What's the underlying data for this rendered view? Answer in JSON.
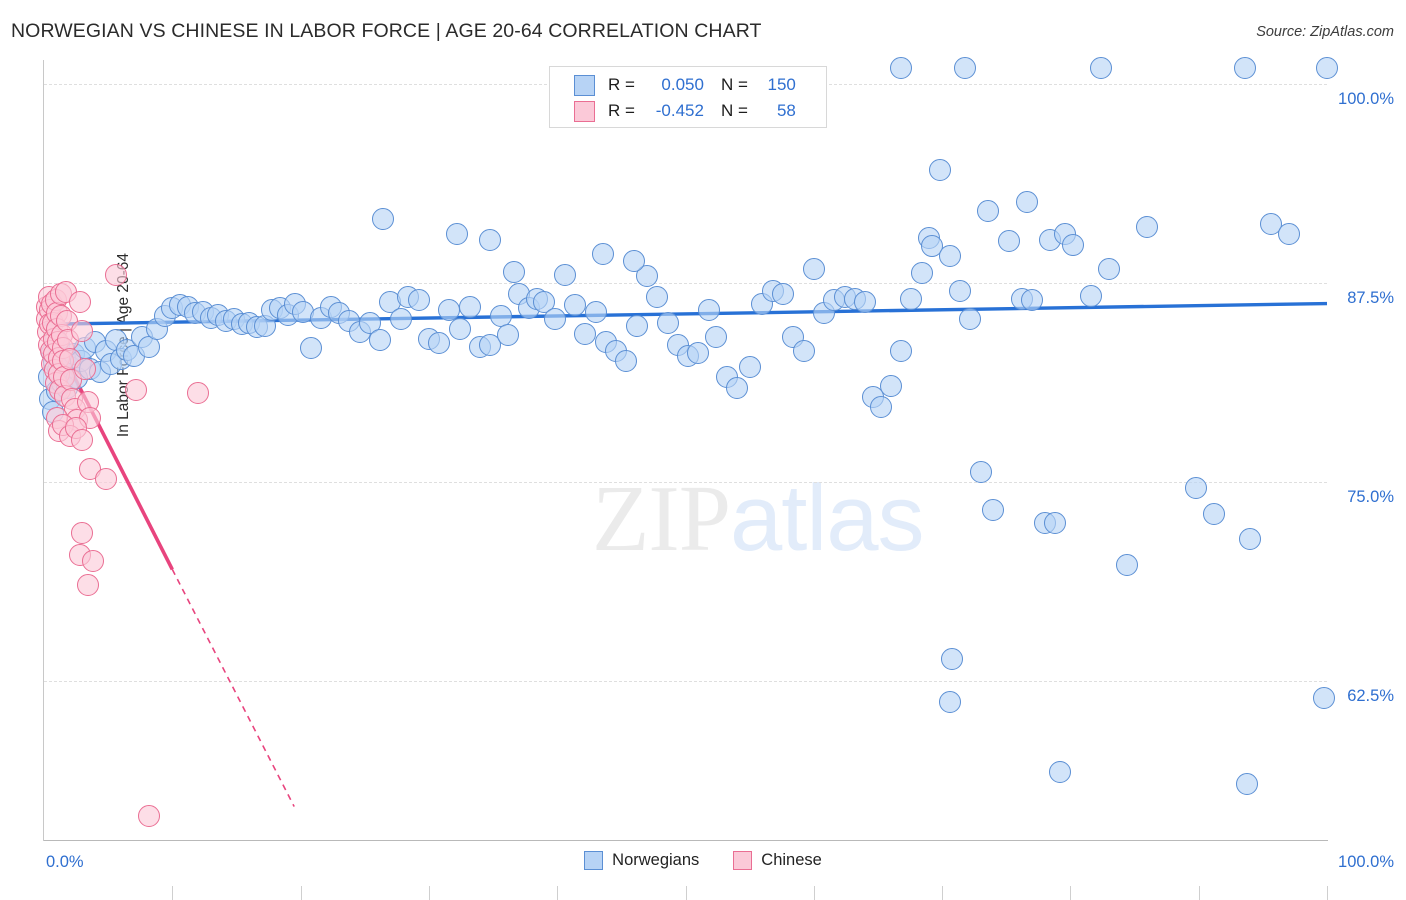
{
  "header": {
    "title": "NORWEGIAN VS CHINESE IN LABOR FORCE | AGE 20-64 CORRELATION CHART",
    "source": "Source: ZipAtlas.com"
  },
  "watermark": {
    "part1": "ZIP",
    "part2": "atlas"
  },
  "stats": {
    "rows": [
      {
        "swatch": "blue",
        "r_key": "R =",
        "r_value": "0.050",
        "n_key": "N =",
        "n_value": "150"
      },
      {
        "swatch": "pink",
        "r_key": "R =",
        "r_value": "-0.452",
        "n_key": "N =",
        "n_value": "58"
      }
    ]
  },
  "legend": {
    "items": [
      {
        "label": "Norwegians",
        "color": "#b7d3f5"
      },
      {
        "label": "Chinese",
        "color": "#fbc9d8"
      }
    ]
  },
  "axes": {
    "y_title": "In Labor Force | Age 20-64",
    "y_ticks": [
      "100.0%",
      "87.5%",
      "75.0%",
      "62.5%"
    ],
    "x_ticks": [
      "0.0%",
      "100.0%"
    ]
  },
  "colors": {
    "accent_blue": "#2f6fd0",
    "series_blue_fill": "#b7d3f5",
    "series_blue_stroke": "#5b8fd4",
    "series_pink_fill": "#fbc9d8",
    "series_pink_stroke": "#ea6e93",
    "trend_blue": "#2871d6",
    "trend_pink": "#e8447e",
    "grid": "#dfdfdf",
    "title_text": "#2b2b2b"
  },
  "chart_data": {
    "type": "scatter",
    "title": "NORWEGIAN VS CHINESE IN LABOR FORCE | AGE 20-64 CORRELATION CHART",
    "xlabel": "",
    "ylabel": "In Labor Force | Age 20-64",
    "xlim": [
      0,
      100
    ],
    "ylim": [
      52.5,
      101.5
    ],
    "x_tick_values": [
      0,
      100
    ],
    "y_tick_values": [
      62.5,
      75.0,
      87.5,
      100.0
    ],
    "grid": "horizontal-dashed",
    "legend_position": "bottom-center",
    "series": [
      {
        "name": "Norwegians",
        "color": "#b7d3f5",
        "r": 0.05,
        "n": 150,
        "trendline": {
          "x0": 0,
          "y0": 84.9,
          "x1": 100,
          "y1": 86.2,
          "style": "solid",
          "color": "#2871d6"
        },
        "points": [
          [
            0.4,
            81.6
          ],
          [
            0.5,
            80.2
          ],
          [
            0.6,
            83.1
          ],
          [
            0.7,
            79.4
          ],
          [
            0.8,
            82.5
          ],
          [
            0.9,
            84.0
          ],
          [
            1.0,
            80.7
          ],
          [
            1.1,
            82.0
          ],
          [
            1.2,
            83.6
          ],
          [
            1.4,
            81.2
          ],
          [
            1.6,
            82.8
          ],
          [
            1.8,
            80.9
          ],
          [
            2.0,
            82.2
          ],
          [
            2.3,
            83.0
          ],
          [
            2.6,
            81.5
          ],
          [
            2.9,
            82.6
          ],
          [
            3.2,
            83.4
          ],
          [
            3.6,
            82.1
          ],
          [
            4.0,
            83.8
          ],
          [
            4.4,
            81.9
          ],
          [
            4.8,
            83.2
          ],
          [
            5.2,
            82.4
          ],
          [
            5.6,
            83.9
          ],
          [
            6.0,
            82.7
          ],
          [
            6.5,
            83.3
          ],
          [
            7.0,
            82.9
          ],
          [
            7.6,
            84.1
          ],
          [
            8.2,
            83.5
          ],
          [
            8.8,
            84.6
          ],
          [
            9.4,
            85.4
          ],
          [
            10.0,
            85.9
          ],
          [
            10.6,
            86.1
          ],
          [
            11.2,
            86.0
          ],
          [
            11.8,
            85.6
          ],
          [
            12.4,
            85.7
          ],
          [
            13.0,
            85.3
          ],
          [
            13.6,
            85.5
          ],
          [
            14.2,
            85.1
          ],
          [
            14.8,
            85.2
          ],
          [
            15.4,
            84.9
          ],
          [
            16.0,
            85.0
          ],
          [
            16.6,
            84.7
          ],
          [
            17.2,
            84.8
          ],
          [
            17.8,
            85.8
          ],
          [
            18.4,
            85.9
          ],
          [
            19.0,
            85.5
          ],
          [
            19.6,
            86.2
          ],
          [
            20.2,
            85.7
          ],
          [
            20.8,
            83.4
          ],
          [
            21.6,
            85.3
          ],
          [
            22.4,
            86.0
          ],
          [
            23.0,
            85.6
          ],
          [
            23.8,
            85.1
          ],
          [
            24.6,
            84.4
          ],
          [
            25.4,
            85.0
          ],
          [
            26.2,
            83.9
          ],
          [
            27.0,
            86.3
          ],
          [
            27.8,
            85.2
          ],
          [
            28.4,
            86.6
          ],
          [
            29.2,
            86.4
          ],
          [
            30.0,
            84.0
          ],
          [
            30.8,
            83.7
          ],
          [
            31.6,
            85.8
          ],
          [
            32.4,
            84.6
          ],
          [
            33.2,
            86.0
          ],
          [
            34.0,
            83.5
          ],
          [
            34.8,
            83.6
          ],
          [
            35.6,
            85.4
          ],
          [
            36.2,
            84.2
          ],
          [
            37.0,
            86.8
          ],
          [
            37.8,
            85.9
          ],
          [
            38.4,
            86.5
          ],
          [
            39.0,
            86.3
          ],
          [
            39.8,
            85.2
          ],
          [
            40.6,
            88.0
          ],
          [
            41.4,
            86.1
          ],
          [
            42.2,
            84.3
          ],
          [
            43.0,
            85.7
          ],
          [
            43.8,
            83.8
          ],
          [
            44.6,
            83.2
          ],
          [
            45.4,
            82.6
          ],
          [
            46.2,
            84.8
          ],
          [
            47.0,
            87.9
          ],
          [
            47.8,
            86.6
          ],
          [
            48.6,
            85.0
          ],
          [
            49.4,
            83.6
          ],
          [
            50.2,
            82.9
          ],
          [
            51.0,
            83.1
          ],
          [
            51.8,
            85.8
          ],
          [
            52.4,
            84.1
          ],
          [
            26.4,
            91.5
          ],
          [
            32.2,
            90.6
          ],
          [
            34.8,
            90.2
          ],
          [
            36.6,
            88.2
          ],
          [
            43.6,
            89.3
          ],
          [
            46.0,
            88.9
          ],
          [
            53.2,
            81.6
          ],
          [
            54.0,
            80.9
          ],
          [
            55.0,
            82.2
          ],
          [
            56.0,
            86.2
          ],
          [
            56.8,
            87.0
          ],
          [
            57.6,
            86.8
          ],
          [
            58.4,
            84.1
          ],
          [
            59.2,
            83.2
          ],
          [
            60.0,
            88.4
          ],
          [
            60.8,
            85.6
          ],
          [
            61.6,
            86.4
          ],
          [
            62.4,
            86.6
          ],
          [
            63.2,
            86.5
          ],
          [
            64.0,
            86.3
          ],
          [
            64.6,
            80.3
          ],
          [
            65.2,
            79.7
          ],
          [
            66.0,
            81.0
          ],
          [
            66.8,
            83.2
          ],
          [
            67.6,
            86.5
          ],
          [
            68.4,
            88.1
          ],
          [
            69.0,
            90.3
          ],
          [
            69.2,
            89.8
          ],
          [
            69.8,
            94.6
          ],
          [
            70.6,
            89.2
          ],
          [
            71.4,
            87.0
          ],
          [
            72.2,
            85.2
          ],
          [
            73.0,
            75.6
          ],
          [
            74.0,
            73.2
          ],
          [
            75.2,
            90.1
          ],
          [
            76.2,
            86.5
          ],
          [
            77.0,
            86.4
          ],
          [
            78.0,
            72.4
          ],
          [
            78.8,
            72.4
          ],
          [
            79.2,
            56.8
          ],
          [
            70.8,
            63.9
          ],
          [
            70.6,
            61.2
          ],
          [
            73.6,
            92.0
          ],
          [
            76.6,
            92.6
          ],
          [
            78.4,
            90.2
          ],
          [
            79.6,
            90.6
          ],
          [
            80.2,
            89.9
          ],
          [
            81.6,
            86.7
          ],
          [
            83.0,
            88.4
          ],
          [
            84.4,
            69.8
          ],
          [
            86.0,
            91.0
          ],
          [
            89.8,
            74.6
          ],
          [
            91.2,
            73.0
          ],
          [
            94.0,
            71.4
          ],
          [
            95.6,
            91.2
          ],
          [
            97.0,
            90.6
          ],
          [
            99.8,
            61.4
          ],
          [
            93.8,
            56.0
          ],
          [
            66.8,
            101.0
          ],
          [
            71.8,
            101.0
          ],
          [
            82.4,
            101.0
          ],
          [
            93.6,
            101.0
          ],
          [
            100.0,
            101.0
          ]
        ]
      },
      {
        "name": "Chinese",
        "color": "#fbc9d8",
        "r": -0.452,
        "n": 58,
        "trendline": {
          "solid": {
            "x0": 1.6,
            "y0": 82.8,
            "x1": 10.0,
            "y1": 69.5
          },
          "dashed": {
            "x0": 10.0,
            "y0": 69.5,
            "x1": 19.5,
            "y1": 54.6
          },
          "color": "#e8447e"
        },
        "points": [
          [
            0.2,
            86.0
          ],
          [
            0.25,
            85.2
          ],
          [
            0.3,
            84.4
          ],
          [
            0.35,
            83.6
          ],
          [
            0.4,
            86.6
          ],
          [
            0.45,
            85.8
          ],
          [
            0.5,
            84.9
          ],
          [
            0.55,
            83.2
          ],
          [
            0.6,
            82.4
          ],
          [
            0.65,
            86.2
          ],
          [
            0.7,
            85.0
          ],
          [
            0.75,
            84.0
          ],
          [
            0.8,
            83.0
          ],
          [
            0.85,
            82.0
          ],
          [
            0.9,
            81.2
          ],
          [
            0.95,
            86.4
          ],
          [
            1.0,
            85.6
          ],
          [
            1.05,
            84.6
          ],
          [
            1.1,
            83.8
          ],
          [
            1.15,
            82.8
          ],
          [
            1.2,
            81.8
          ],
          [
            1.25,
            80.8
          ],
          [
            1.3,
            86.8
          ],
          [
            1.35,
            85.4
          ],
          [
            1.4,
            84.2
          ],
          [
            1.45,
            83.4
          ],
          [
            1.5,
            82.6
          ],
          [
            1.55,
            81.6
          ],
          [
            1.6,
            80.4
          ],
          [
            1.7,
            86.9
          ],
          [
            1.8,
            85.1
          ],
          [
            1.9,
            83.9
          ],
          [
            2.0,
            82.7
          ],
          [
            2.1,
            81.4
          ],
          [
            2.2,
            80.2
          ],
          [
            2.4,
            79.6
          ],
          [
            2.6,
            78.9
          ],
          [
            2.8,
            86.3
          ],
          [
            3.0,
            84.5
          ],
          [
            3.2,
            82.1
          ],
          [
            3.4,
            80.0
          ],
          [
            3.6,
            79.0
          ],
          [
            1.0,
            79.0
          ],
          [
            1.2,
            78.2
          ],
          [
            1.5,
            78.6
          ],
          [
            2.0,
            77.9
          ],
          [
            2.5,
            78.4
          ],
          [
            3.0,
            77.6
          ],
          [
            5.6,
            88.0
          ],
          [
            7.2,
            80.8
          ],
          [
            12.0,
            80.6
          ],
          [
            3.6,
            75.8
          ],
          [
            4.8,
            75.2
          ],
          [
            3.0,
            71.8
          ],
          [
            2.8,
            70.4
          ],
          [
            3.8,
            70.0
          ],
          [
            3.4,
            68.5
          ],
          [
            8.2,
            54.0
          ]
        ]
      }
    ]
  }
}
